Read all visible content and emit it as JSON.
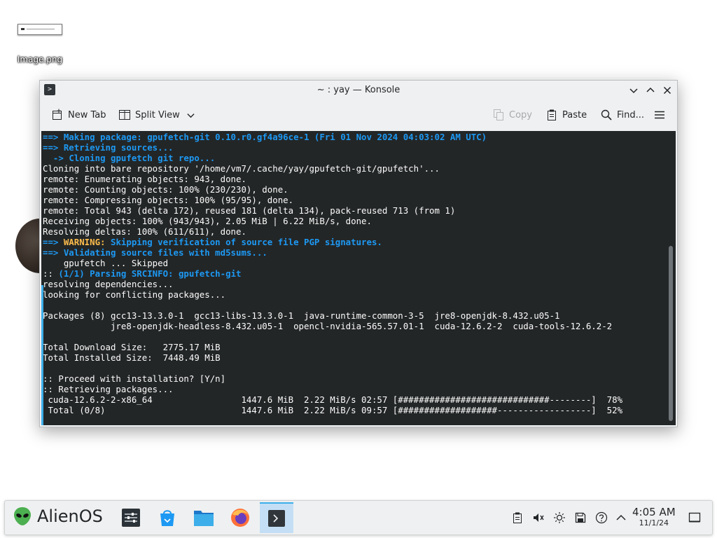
{
  "desktop": {
    "icons": [
      {
        "label": "Image.png",
        "icon": "image-file-icon"
      }
    ]
  },
  "window": {
    "title": "~ : yay — Konsole",
    "toolbar": {
      "new_tab": "New Tab",
      "split_view": "Split View",
      "copy": "Copy",
      "paste": "Paste",
      "find": "Find..."
    }
  },
  "terminal": {
    "lines": [
      [
        {
          "t": "==> ",
          "c": "c-blue"
        },
        {
          "t": "Making package: gpufetch-git 0.10.r0.gf4a96ce-1 (Fri 01 Nov 2024 04:03:02 AM UTC)",
          "c": "c-blue"
        }
      ],
      [
        {
          "t": "==> ",
          "c": "c-blue"
        },
        {
          "t": "Retrieving sources...",
          "c": "c-blue"
        }
      ],
      [
        {
          "t": "  -> ",
          "c": "c-blue"
        },
        {
          "t": "Cloning gpufetch git repo...",
          "c": "c-blue"
        }
      ],
      [
        {
          "t": "Cloning into bare repository '/home/vm7/.cache/yay/gpufetch-git/gpufetch'...",
          "c": ""
        }
      ],
      [
        {
          "t": "remote: Enumerating objects: 943, done.",
          "c": ""
        }
      ],
      [
        {
          "t": "remote: Counting objects: 100% (230/230), done.",
          "c": ""
        }
      ],
      [
        {
          "t": "remote: Compressing objects: 100% (95/95), done.",
          "c": ""
        }
      ],
      [
        {
          "t": "remote: Total 943 (delta 172), reused 181 (delta 134), pack-reused 713 (from 1)",
          "c": ""
        }
      ],
      [
        {
          "t": "Receiving objects: 100% (943/943), 2.05 MiB | 6.22 MiB/s, done.",
          "c": ""
        }
      ],
      [
        {
          "t": "Resolving deltas: 100% (611/611), done.",
          "c": ""
        }
      ],
      [
        {
          "t": "==> ",
          "c": "c-blue"
        },
        {
          "t": "WARNING: ",
          "c": "c-yellow"
        },
        {
          "t": "Skipping verification of source file PGP signatures.",
          "c": "c-blue"
        }
      ],
      [
        {
          "t": "==> ",
          "c": "c-blue"
        },
        {
          "t": "Validating source files with md5sums...",
          "c": "c-blue"
        }
      ],
      [
        {
          "t": "    gpufetch ... Skipped",
          "c": ""
        }
      ],
      [
        {
          "t": ":: ",
          "c": ""
        },
        {
          "t": "(1/1) Parsing SRCINFO: gpufetch-git",
          "c": "c-blue"
        }
      ],
      [
        {
          "t": "resolving dependencies...",
          "c": ""
        }
      ],
      [
        {
          "t": "looking for conflicting packages...",
          "c": ""
        }
      ],
      [
        {
          "t": "",
          "c": ""
        }
      ],
      [
        {
          "t": "Packages (8) gcc13-13.3.0-1  gcc13-libs-13.3.0-1  java-runtime-common-3-5  jre8-openjdk-8.432.u05-1",
          "c": ""
        }
      ],
      [
        {
          "t": "             jre8-openjdk-headless-8.432.u05-1  opencl-nvidia-565.57.01-1  cuda-12.6.2-2  cuda-tools-12.6.2-2",
          "c": ""
        }
      ],
      [
        {
          "t": "",
          "c": ""
        }
      ],
      [
        {
          "t": "Total Download Size:   2775.17 MiB",
          "c": ""
        }
      ],
      [
        {
          "t": "Total Installed Size:  7448.49 MiB",
          "c": ""
        }
      ],
      [
        {
          "t": "",
          "c": ""
        }
      ],
      [
        {
          "t": ":: Proceed with installation? [Y/n]",
          "c": ""
        }
      ],
      [
        {
          "t": ":: Retrieving packages...",
          "c": ""
        }
      ],
      [
        {
          "t": " cuda-12.6.2-2-x86_64                 1447.6 MiB  2.22 MiB/s 02:57 [#############################--------]  78%",
          "c": ""
        }
      ],
      [
        {
          "t": " Total (0/8)                          1447.6 MiB  2.22 MiB/s 09:57 [###################------------------]  52%",
          "c": ""
        }
      ]
    ]
  },
  "taskbar": {
    "launcher_label": "AlienOS",
    "apps": [
      {
        "name": "system-settings-icon"
      },
      {
        "name": "discover-store-icon"
      },
      {
        "name": "file-manager-icon"
      },
      {
        "name": "firefox-icon"
      },
      {
        "name": "konsole-icon"
      }
    ],
    "clock": {
      "time": "4:05 AM",
      "date": "11/1/24"
    }
  },
  "colors": {
    "accent": "#3daee9",
    "terminal_bg": "#232627",
    "term_blue": "#1d99f3",
    "term_yellow": "#fdbc4b"
  }
}
